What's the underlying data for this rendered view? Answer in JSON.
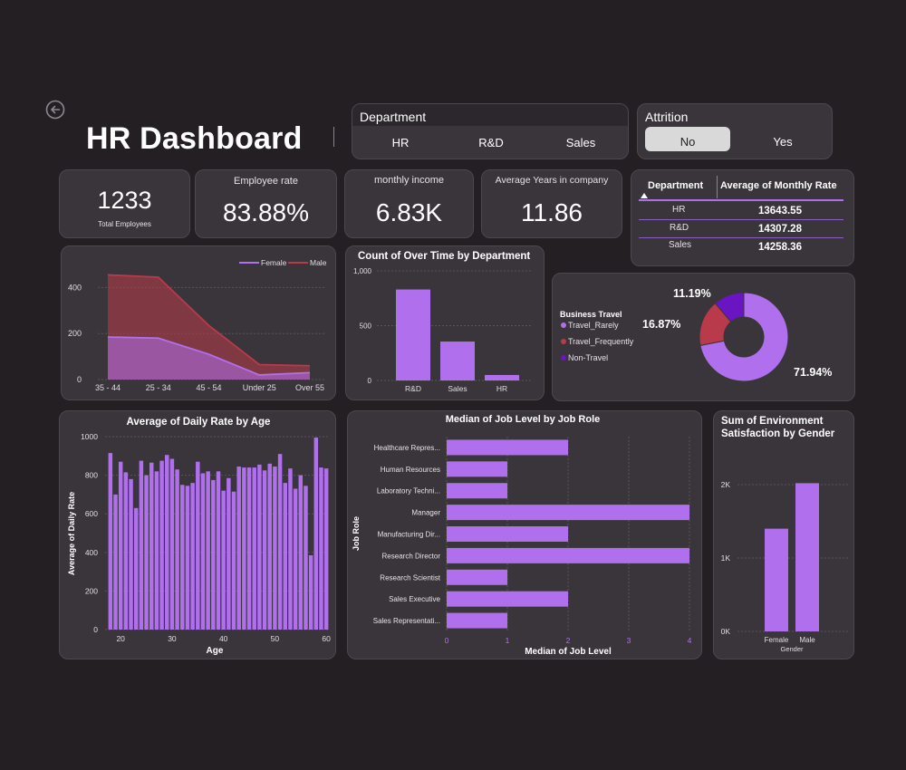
{
  "page": {
    "title": "HR Dashboard"
  },
  "department_slicer": {
    "title": "Department",
    "options": [
      "HR",
      "R&D",
      "Sales"
    ]
  },
  "attrition_slicer": {
    "title": "Attrition",
    "options": [
      "No",
      "Yes"
    ],
    "selected": "No"
  },
  "kpis": {
    "total_employees": {
      "value": "1233",
      "label": "Total Employees"
    },
    "employee_rate": {
      "label": "Employee rate",
      "value": "83.88%"
    },
    "monthly_income": {
      "label": "monthly income",
      "value": "6.83K"
    },
    "avg_years": {
      "label": "Average Years in company",
      "value": "11.86"
    }
  },
  "rate_table": {
    "headers": [
      "Department",
      "Average of Monthly Rate"
    ],
    "rows": [
      {
        "dept": "HR",
        "rate": "13643.55"
      },
      {
        "dept": "R&D",
        "rate": "14307.28"
      },
      {
        "dept": "Sales",
        "rate": "14258.36"
      }
    ]
  },
  "colors": {
    "purple": "#b070ee",
    "red": "#b93a4a",
    "darkpurple": "#6b14c4",
    "bg": "#231f23",
    "card": "#3a353b"
  },
  "chart_data": [
    {
      "id": "age_gender_area",
      "type": "area",
      "title": "",
      "categories": [
        "35 - 44",
        "25 - 34",
        "45 - 54",
        "Under 25",
        "Over 55"
      ],
      "series": [
        {
          "name": "Female",
          "values": [
            185,
            180,
            110,
            20,
            30
          ]
        },
        {
          "name": "Male",
          "values": [
            455,
            445,
            235,
            65,
            60
          ]
        }
      ],
      "yticks": [
        "400",
        "200",
        "0"
      ],
      "ylim": [
        0,
        500
      ],
      "legend": "top-right"
    },
    {
      "id": "overtime_by_dept",
      "type": "bar",
      "title": "Count of Over Time by Department",
      "categories": [
        "R&D",
        "Sales",
        "HR"
      ],
      "values": [
        830,
        355,
        50
      ],
      "yticks": [
        "1,000",
        "500",
        "0"
      ],
      "ylim": [
        0,
        1000
      ]
    },
    {
      "id": "business_travel",
      "type": "pie",
      "legend_title": "Business Travel",
      "labels": [
        "Travel_Rarely",
        "Travel_Frequently",
        "Non-Travel"
      ],
      "values": [
        71.94,
        16.87,
        11.19
      ],
      "value_labels": [
        "71.94%",
        "16.87%",
        "11.19%"
      ]
    },
    {
      "id": "daily_rate_by_age",
      "type": "bar",
      "title": "Average of Daily Rate by Age",
      "xlabel": "Age",
      "ylabel": "Average of Daily Rate",
      "x": [
        18,
        19,
        20,
        21,
        22,
        23,
        24,
        25,
        26,
        27,
        28,
        29,
        30,
        31,
        32,
        33,
        34,
        35,
        36,
        37,
        38,
        39,
        40,
        41,
        42,
        43,
        44,
        45,
        46,
        47,
        48,
        49,
        50,
        51,
        52,
        53,
        54,
        55,
        56,
        57,
        58,
        59,
        60
      ],
      "values": [
        915,
        700,
        870,
        815,
        780,
        630,
        875,
        800,
        865,
        820,
        875,
        905,
        885,
        830,
        750,
        745,
        760,
        870,
        810,
        820,
        775,
        820,
        720,
        785,
        715,
        845,
        840,
        840,
        840,
        855,
        825,
        860,
        845,
        910,
        760,
        835,
        730,
        800,
        745,
        385,
        995,
        840,
        835
      ],
      "xticks": [
        "20",
        "30",
        "40",
        "50",
        "60"
      ],
      "yticks": [
        "1000",
        "800",
        "600",
        "400",
        "200",
        "0"
      ],
      "ylim": [
        0,
        1000
      ]
    },
    {
      "id": "job_level_by_role",
      "type": "bar",
      "orientation": "horizontal",
      "title": "Median of Job Level by Job Role",
      "xlabel": "Median of Job Level",
      "ylabel": "Job Role",
      "categories": [
        "Healthcare Repres...",
        "Human Resources",
        "Laboratory Techni...",
        "Manager",
        "Manufacturing Dir...",
        "Research Director",
        "Research Scientist",
        "Sales Executive",
        "Sales Representati..."
      ],
      "values": [
        2,
        1,
        1,
        4,
        2,
        4,
        1,
        2,
        1
      ],
      "xticks": [
        "0",
        "1",
        "2",
        "3",
        "4"
      ],
      "xlim": [
        0,
        4
      ]
    },
    {
      "id": "env_satisfaction_by_gender",
      "type": "bar",
      "title": "Sum of Environment Satisfaction by Gender",
      "title_lines": [
        "Sum of Environment",
        "Satisfaction by Gender"
      ],
      "xlabel": "Gender",
      "categories": [
        "Female",
        "Male"
      ],
      "values": [
        1400,
        2020
      ],
      "yticks": [
        "2K",
        "1K",
        "0K"
      ],
      "ylim": [
        0,
        2000
      ]
    }
  ]
}
